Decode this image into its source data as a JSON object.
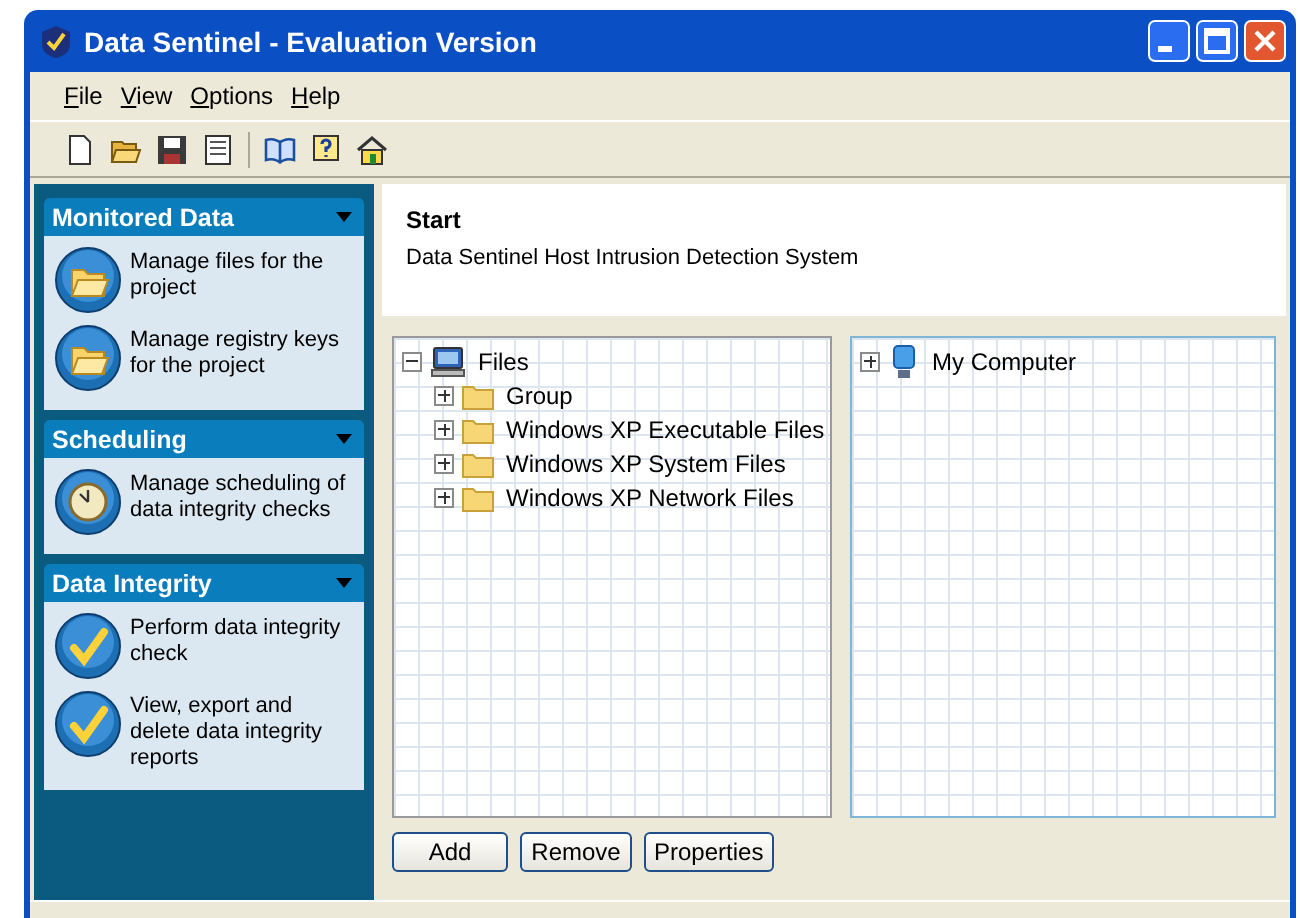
{
  "window": {
    "title": "Data Sentinel - Evaluation Version"
  },
  "menu": [
    "File",
    "View",
    "Options",
    "Help"
  ],
  "sidebar": {
    "sections": [
      {
        "title": "Monitored Data",
        "items": [
          {
            "kind": "folder",
            "label": "Manage files for the project"
          },
          {
            "kind": "folder",
            "label": "Manage registry keys for the project"
          }
        ]
      },
      {
        "title": "Scheduling",
        "items": [
          {
            "kind": "clock",
            "label": "Manage scheduling of data integrity checks"
          }
        ]
      },
      {
        "title": "Data Integrity",
        "items": [
          {
            "kind": "check",
            "label": "Perform data integrity check"
          },
          {
            "kind": "check",
            "label": "View, export and delete data integrity reports"
          }
        ]
      }
    ]
  },
  "header": {
    "title": "Start",
    "subtitle": "Data Sentinel Host Intrusion Detection System"
  },
  "file_tree": {
    "label": "Files",
    "kind": "computer",
    "expanded": true,
    "children": [
      {
        "label": "Group",
        "kind": "folder",
        "expanded": false
      },
      {
        "label": "Windows XP Executable Files",
        "kind": "folder",
        "expanded": false
      },
      {
        "label": "Windows XP System Files",
        "kind": "folder",
        "expanded": false
      },
      {
        "label": "Windows XP Network Files",
        "kind": "folder",
        "expanded": false
      }
    ]
  },
  "computer_tree": {
    "label": "My Computer",
    "kind": "monitor",
    "expanded": false
  },
  "buttons": [
    "Add",
    "Remove",
    "Properties"
  ]
}
